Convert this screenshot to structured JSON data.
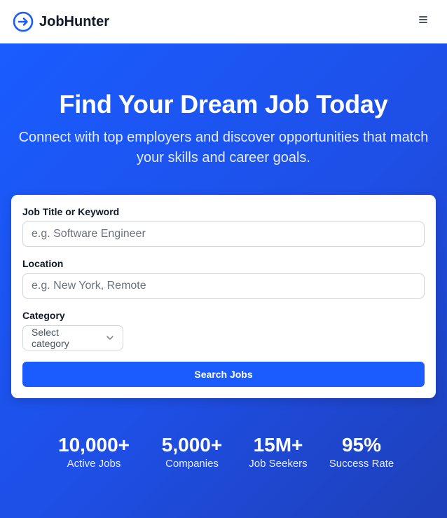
{
  "header": {
    "brand": "JobHunter",
    "logo_icon": "arrow-circle-icon",
    "menu_icon": "hamburger-menu-icon",
    "brand_color": "#1a5cff"
  },
  "hero": {
    "title": "Find Your Dream Job Today",
    "subtitle": "Connect with top employers and discover opportunities that match your skills and career goals."
  },
  "search": {
    "keyword_label": "Job Title or Keyword",
    "keyword_placeholder": "e.g. Software Engineer",
    "location_label": "Location",
    "location_placeholder": "e.g. New York, Remote",
    "category_label": "Category",
    "category_selected": "Select category",
    "button_label": "Search Jobs"
  },
  "stats": [
    {
      "value": "10,000+",
      "label": "Active Jobs"
    },
    {
      "value": "5,000+",
      "label": "Companies"
    },
    {
      "value": "15M+",
      "label": "Job Seekers"
    },
    {
      "value": "95%",
      "label": "Success Rate"
    }
  ]
}
